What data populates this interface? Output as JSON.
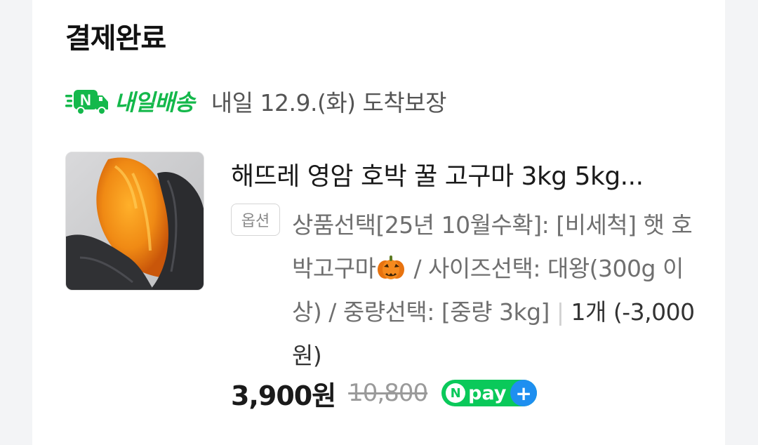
{
  "order": {
    "status_title": "결제완료",
    "delivery": {
      "brand": "내일배송",
      "text": "내일 12.9.(화) 도착보장"
    },
    "product": {
      "name": "해뜨레 영암 호박 꿀 고구마 3kg 5kg...",
      "option_label": "옵션",
      "option_part1": "상품선택[25년 10월수확]: [비세척] 햇 호박고구마",
      "option_part2": " / 사이즈선택: 대왕(300g 이상) / 중량선택: [중량 3kg]",
      "separator": "|",
      "quantity": "1개 (-3,000원)",
      "price": "3,900원",
      "original_price": "10,800",
      "pay_badge": {
        "n_letter": "N",
        "word": "pay",
        "plus": "+"
      }
    }
  },
  "colors": {
    "delivery_green": "#14b84b",
    "npay_green": "#0ac95a",
    "npay_blue": "#1e8ff0",
    "background": "#f3f4f6"
  },
  "icons": {
    "delivery": "n-delivery-truck-icon",
    "option_emoji": "pumpkin-icon"
  }
}
